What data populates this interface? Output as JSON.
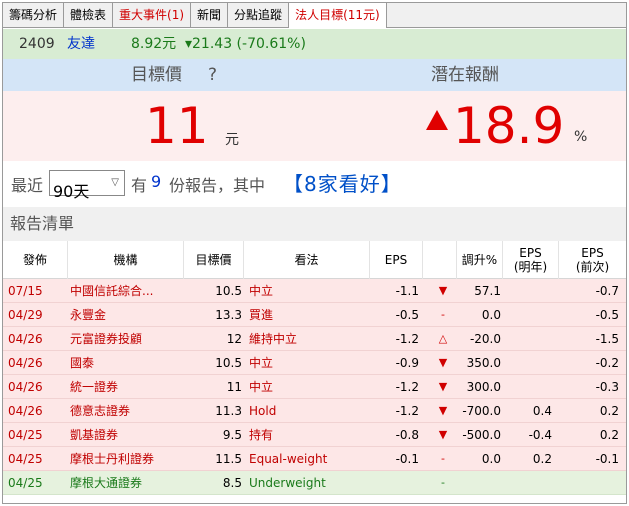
{
  "tabs": [
    {
      "label": "籌碼分析",
      "style": "normal"
    },
    {
      "label": "體檢表",
      "style": "normal"
    },
    {
      "label": "重大事件(1)",
      "style": "red"
    },
    {
      "label": "新聞",
      "style": "normal"
    },
    {
      "label": "分點追蹤",
      "style": "normal"
    },
    {
      "label": "法人目標(11元)",
      "style": "active"
    }
  ],
  "stock": {
    "code": "2409",
    "name": "友達",
    "price": "8.92元",
    "change": "▾21.43 (-70.61%)"
  },
  "summary": {
    "target_label": "目標價",
    "help_icon": "?",
    "potential_label": "潛在報酬",
    "target_value": "11",
    "target_unit": "元",
    "potential_value": "18.9",
    "potential_unit": "%",
    "direction_icon": "up-triangle-icon"
  },
  "period": {
    "prefix": "最近",
    "selected": "90天",
    "middle": "有",
    "count": "9",
    "suffix": "份報告，其中",
    "bullish": "【8家看好】"
  },
  "list": {
    "title": "報告清單",
    "columns": {
      "date": "發佈",
      "org": "機構",
      "target": "目標價",
      "view": "看法",
      "eps": "EPS",
      "adj": "調升%",
      "eps_next": "EPS\n(明年)",
      "eps_prev": "EPS\n(前次)"
    },
    "rows": [
      {
        "date": "07/15",
        "org": "中國信託綜合...",
        "target": "10.5",
        "view": "中立",
        "eps": "-1.1",
        "arrow": "▼",
        "adj": "57.1",
        "eps_next": "",
        "eps_prev": "-0.7",
        "tone": "pink"
      },
      {
        "date": "04/29",
        "org": "永豐金",
        "target": "13.3",
        "view": "買進",
        "eps": "-0.5",
        "arrow": "-",
        "adj": "0.0",
        "eps_next": "",
        "eps_prev": "-0.5",
        "tone": "pink"
      },
      {
        "date": "04/26",
        "org": "元富證券投顧",
        "target": "12",
        "view": "維持中立",
        "eps": "-1.2",
        "arrow": "△",
        "adj": "-20.0",
        "eps_next": "",
        "eps_prev": "-1.5",
        "tone": "pink"
      },
      {
        "date": "04/26",
        "org": "國泰",
        "target": "10.5",
        "view": "中立",
        "eps": "-0.9",
        "arrow": "▼",
        "adj": "350.0",
        "eps_next": "",
        "eps_prev": "-0.2",
        "tone": "pink"
      },
      {
        "date": "04/26",
        "org": "統一證券",
        "target": "11",
        "view": "中立",
        "eps": "-1.2",
        "arrow": "▼",
        "adj": "300.0",
        "eps_next": "",
        "eps_prev": "-0.3",
        "tone": "pink"
      },
      {
        "date": "04/26",
        "org": "德意志證券",
        "target": "11.3",
        "view": "Hold",
        "eps": "-1.2",
        "arrow": "▼",
        "adj": "-700.0",
        "eps_next": "0.4",
        "eps_prev": "0.2",
        "tone": "pink"
      },
      {
        "date": "04/25",
        "org": "凱基證券",
        "target": "9.5",
        "view": "持有",
        "eps": "-0.8",
        "arrow": "▼",
        "adj": "-500.0",
        "eps_next": "-0.4",
        "eps_prev": "0.2",
        "tone": "pink"
      },
      {
        "date": "04/25",
        "org": "摩根士丹利證券",
        "target": "11.5",
        "view": "Equal-weight",
        "eps": "-0.1",
        "arrow": "-",
        "adj": "0.0",
        "eps_next": "0.2",
        "eps_prev": "-0.1",
        "tone": "pink"
      },
      {
        "date": "04/25",
        "org": "摩根大通證券",
        "target": "8.5",
        "view": "Underweight",
        "eps": "",
        "arrow": "-",
        "adj": "",
        "eps_next": "",
        "eps_prev": "",
        "tone": "green"
      }
    ]
  },
  "colors": {
    "accent_red": "#e00000",
    "bull_blue": "#0050c8",
    "header_blue": "#d4e5f7",
    "stock_green": "#d8ecd3",
    "row_pink": "#fde7e7",
    "row_green": "#e6f2de"
  }
}
